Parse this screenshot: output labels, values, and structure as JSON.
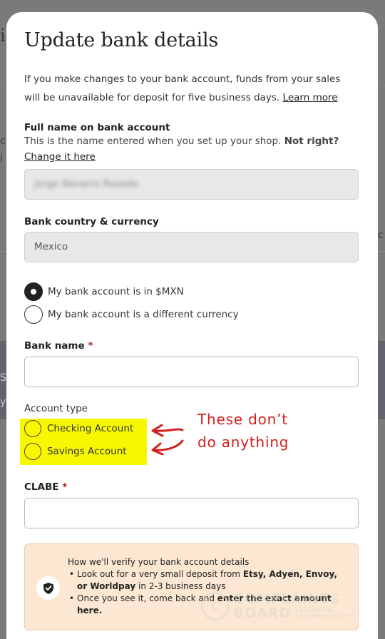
{
  "background_page": {
    "fragments": [
      "i",
      "c",
      "i",
      "c",
      "S",
      "y"
    ]
  },
  "modal": {
    "title": "Update bank details",
    "intro_text": "If you make changes to your bank account, funds from your sales will be unavailable for deposit for five business days.",
    "learn_more_link": "Learn more"
  },
  "full_name": {
    "label": "Full name on bank account",
    "helper_text": "This is the name entered when you set up your shop.",
    "not_right": "Not right?",
    "change_link": "Change it here",
    "value": "Jorge Navarro Rosado"
  },
  "bank_country": {
    "label": "Bank country & currency",
    "value": "Mexico"
  },
  "currency_options": [
    {
      "label": "My bank account is in $MXN",
      "checked": true
    },
    {
      "label": "My bank account is a different currency",
      "checked": false
    }
  ],
  "bank_name": {
    "label": "Bank name",
    "required_mark": "*",
    "value": ""
  },
  "account_type": {
    "label": "Account type",
    "options": [
      {
        "label": "Checking Account",
        "checked": false
      },
      {
        "label": "Savings Account",
        "checked": false
      }
    ]
  },
  "annotation": {
    "line1": "These don’t",
    "line2": "do anything",
    "color": "#d2201c",
    "highlight_color": "#f7f700"
  },
  "clabe": {
    "label": "CLABE",
    "required_mark": "*",
    "value": ""
  },
  "verify_box": {
    "title": "How we'll verify your bank account details",
    "bullet1_prefix": "Look out for a very small deposit from",
    "bullet1_bold": "Etsy, Adyen, Envoy, or Worldpay",
    "bullet1_suffix": "in 2-3 business days",
    "bullet2_prefix": "Once you see it, come back and",
    "bullet2_bold": "enter the exact amount here.",
    "icon": "shield-check-icon",
    "bg_color": "#fce8d2"
  },
  "watermark": {
    "logo": "C",
    "line1": "COMPLAINTS",
    "line2": "BOARD",
    "line3": "ADVANCING",
    "line4": "CONSUMER RIGHTS"
  }
}
